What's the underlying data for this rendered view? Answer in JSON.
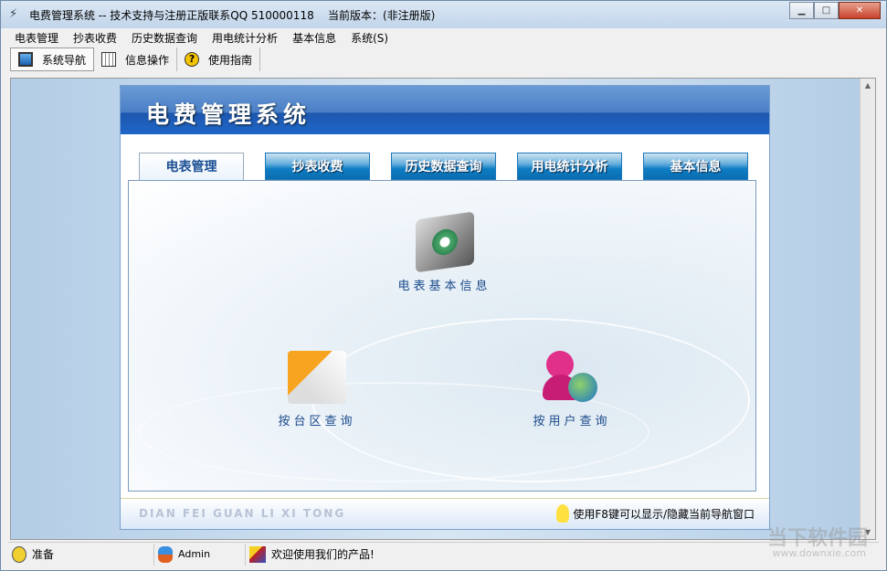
{
  "window": {
    "title": "电费管理系统 -- 技术支持与注册正版联系QQ 510000118    当前版本：(非注册版)"
  },
  "menu": [
    "电表管理",
    "抄表收费",
    "历史数据查询",
    "用电统计分析",
    "基本信息",
    "系统(S)"
  ],
  "toolbar": [
    {
      "label": "系统导航",
      "icon": "monitor-icon"
    },
    {
      "label": "信息操作",
      "icon": "grid-icon"
    },
    {
      "label": "使用指南",
      "icon": "help-icon"
    }
  ],
  "banner": {
    "title": "电费管理系统"
  },
  "tabs": [
    "电表管理",
    "抄表收费",
    "历史数据查询",
    "用电统计分析",
    "基本信息"
  ],
  "nav_items": [
    {
      "label": "电表基本信息",
      "icon": "settings-monitor-icon"
    },
    {
      "label": "按台区查询",
      "icon": "cubes-icon"
    },
    {
      "label": "按用户查询",
      "icon": "user-globe-icon"
    }
  ],
  "footer": {
    "pinyin": "DIAN FEI GUAN LI XI TONG",
    "hint": "使用F8键可以显示/隐藏当前导航窗口"
  },
  "status": {
    "ready": "准备",
    "user": "Admin",
    "welcome": "欢迎使用我们的产品!"
  },
  "watermark": {
    "name": "当下软件园",
    "url": "www.downxie.com"
  }
}
